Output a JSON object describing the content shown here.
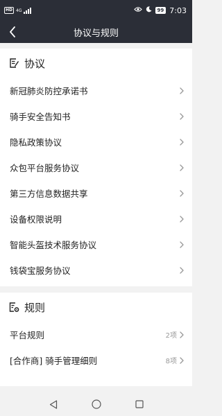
{
  "status_bar": {
    "network": "HD",
    "network_type": "4G",
    "battery": "99",
    "time": "7:03",
    "icons": [
      "eye-icon",
      "moon-icon"
    ]
  },
  "header": {
    "title": "协议与规则",
    "back_icon": "back-arrow-icon"
  },
  "agreements": {
    "title": "协议",
    "icon": "document-edit-icon",
    "items": [
      {
        "label": "新冠肺炎防控承诺书"
      },
      {
        "label": "骑手安全告知书"
      },
      {
        "label": "隐私政策协议"
      },
      {
        "label": "众包平台服务协议"
      },
      {
        "label": "第三方信息数据共享"
      },
      {
        "label": "设备权限说明"
      },
      {
        "label": "智能头盔技术服务协议"
      },
      {
        "label": "钱袋宝服务协议"
      }
    ]
  },
  "rules": {
    "title": "规则",
    "icon": "document-settings-icon",
    "items": [
      {
        "label": "平台规则",
        "count": "2项"
      },
      {
        "label": "[合作商] 骑手管理细则",
        "count": "8项"
      }
    ]
  },
  "system_nav": [
    "back-triangle-icon",
    "home-circle-icon",
    "recents-square-icon"
  ]
}
